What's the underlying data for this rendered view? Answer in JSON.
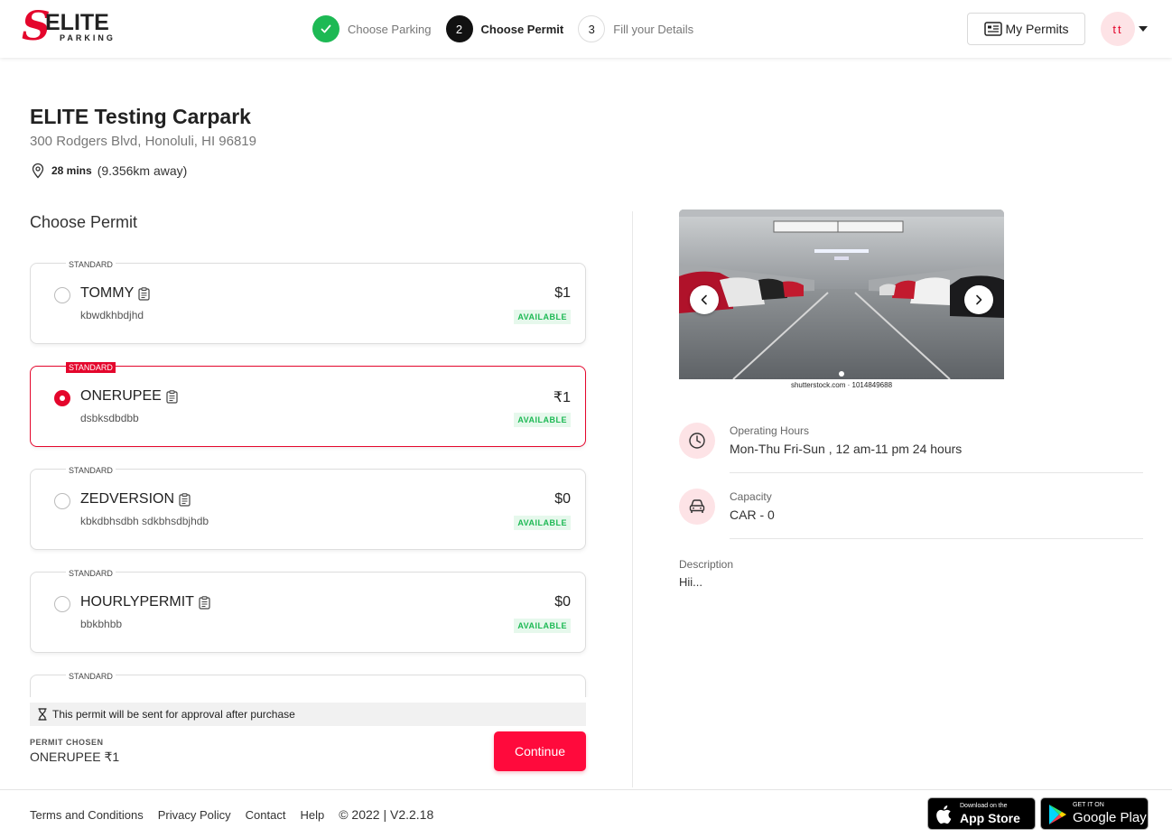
{
  "brand": {
    "logo_letter": "S",
    "logo_word": "ELITE",
    "logo_sub": "PARKING"
  },
  "steps": [
    {
      "number": "✓",
      "label": "Choose Parking",
      "state": "done"
    },
    {
      "number": "2",
      "label": "Choose Permit",
      "state": "active"
    },
    {
      "number": "3",
      "label": "Fill your Details",
      "state": "todo"
    }
  ],
  "header": {
    "my_permits_label": "My Permits",
    "avatar_initials": "tt"
  },
  "carpark": {
    "name": "ELITE Testing Carpark",
    "address": "300 Rodgers Blvd, Honoluli, HI 96819",
    "duration": "28 mins",
    "distance": "(9.356km away)"
  },
  "choose_permit_title": "Choose Permit",
  "permits": [
    {
      "tag": "STANDARD",
      "name": "TOMMY",
      "description": "kbwdkhbdjhd",
      "price": "$1",
      "status": "AVAILABLE",
      "selected": false
    },
    {
      "tag": "STANDARD",
      "name": "ONERUPEE",
      "description": "dsbksdbdbb",
      "price": "₹1",
      "status": "AVAILABLE",
      "selected": true
    },
    {
      "tag": "STANDARD",
      "name": "ZEDVERSION",
      "description": "kbkdbhsdbh sdkbhsdbjhdb",
      "price": "$0",
      "status": "AVAILABLE",
      "selected": false
    },
    {
      "tag": "STANDARD",
      "name": "HOURLYPERMIT",
      "description": "bbkbhbb",
      "price": "$0",
      "status": "AVAILABLE",
      "selected": false
    },
    {
      "tag": "STANDARD",
      "name": "",
      "description": "",
      "price": "",
      "status": "",
      "selected": false
    }
  ],
  "approval_note": "This permit will be sent for approval after purchase",
  "permit_chosen": {
    "label": "PERMIT CHOSEN",
    "value": "ONERUPEE ₹1"
  },
  "continue_label": "Continue",
  "carousel": {
    "credit": "shutterstock.com · 1014849688",
    "slide_count": 1,
    "active_slide": 1
  },
  "details": {
    "hours_label": "Operating Hours",
    "hours_value": "Mon-Thu Fri-Sun , 12 am-11 pm 24 hours",
    "capacity_label": "Capacity",
    "capacity_value": "CAR - 0",
    "description_label": "Description",
    "description_value": "Hii..."
  },
  "footer": {
    "links": [
      "Terms and Conditions",
      "Privacy Policy",
      "Contact",
      "Help"
    ],
    "copyright": "© 2022 | V2.2.18",
    "app_store": {
      "small": "Download on the",
      "big": "App Store"
    },
    "google_play": {
      "small": "GET IT ON",
      "big": "Google Play"
    }
  },
  "colors": {
    "accent": "#e4062c",
    "button": "#ff0a3c",
    "success": "#1db954",
    "icon_bg": "#fde3e6"
  }
}
